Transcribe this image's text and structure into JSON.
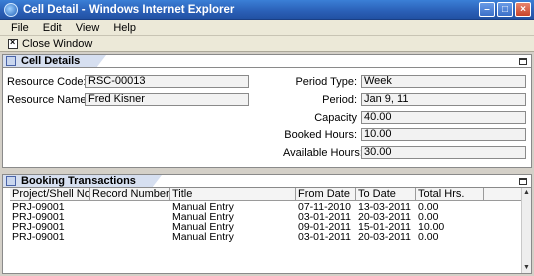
{
  "window": {
    "title": "Cell Detail - Windows Internet Explorer",
    "buttons": {
      "minimize": "–",
      "maximize": "□",
      "close": "×"
    }
  },
  "menu": [
    "File",
    "Edit",
    "View",
    "Help"
  ],
  "toolbar": {
    "close_label": "Close Window"
  },
  "cell_details": {
    "tab_label": "Cell Details",
    "resource_code_label": "Resource Code:",
    "resource_code": "RSC-00013",
    "resource_name_label": "Resource Name:",
    "resource_name": "Fred Kisner",
    "period_type_label": "Period Type:",
    "period_type": "Week",
    "period_label": "Period:",
    "period": "Jan 9, 11",
    "capacity_label": "Capacity",
    "capacity": "40.00",
    "booked_hours_label": "Booked Hours:",
    "booked_hours": "10.00",
    "available_hours_label": "Available Hours:",
    "available_hours": "30.00"
  },
  "booking": {
    "tab_label": "Booking Transactions",
    "columns": [
      "Project/Shell No.",
      "Record Number",
      "Title",
      "From Date",
      "To Date",
      "Total Hrs."
    ],
    "rows": [
      [
        "PRJ-09001",
        "",
        "Manual Entry",
        "07-11-2010",
        "13-03-2011",
        "0.00"
      ],
      [
        "PRJ-09001",
        "",
        "Manual Entry",
        "03-01-2011",
        "20-03-2011",
        "0.00"
      ],
      [
        "PRJ-09001",
        "",
        "Manual Entry",
        "09-01-2011",
        "15-01-2011",
        "10.00"
      ],
      [
        "PRJ-09001",
        "",
        "Manual Entry",
        "03-01-2011",
        "20-03-2011",
        "0.00"
      ]
    ]
  }
}
